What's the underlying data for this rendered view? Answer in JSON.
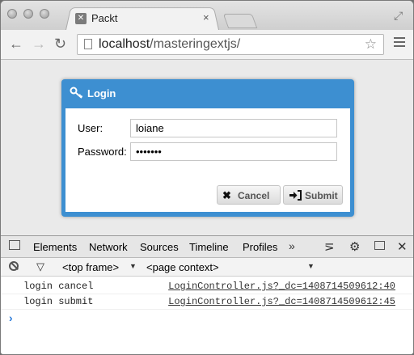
{
  "browser": {
    "tab_title": "Packt",
    "tab_favicon": "packt-favicon",
    "tab_close": "×",
    "url_host": "localhost",
    "url_path": "/masteringextjs/",
    "back_glyph": "←",
    "forward_glyph": "→",
    "reload_glyph": "↻",
    "star_glyph": "☆",
    "fullscreen_glyph": "⤢"
  },
  "login": {
    "title": "Login",
    "icon": "key-icon",
    "user_label": "User:",
    "user_value": "loiane",
    "password_label": "Password:",
    "password_value": "•••••••",
    "cancel_label": "Cancel",
    "cancel_icon": "x-icon",
    "submit_label": "Submit",
    "submit_icon": "sign-in-icon",
    "accent_color": "#3d8fd1"
  },
  "devtools": {
    "tabs": [
      "Elements",
      "Network",
      "Sources",
      "Timeline",
      "Profiles"
    ],
    "more_glyph": "»",
    "frame_select": "<top frame>",
    "context_select": "<page context>",
    "logs": [
      {
        "message": "login cancel",
        "source": "LoginController.js?_dc=1408714509612:40"
      },
      {
        "message": "login submit",
        "source": "LoginController.js?_dc=1408714509612:45"
      }
    ],
    "prompt_glyph": "›"
  }
}
